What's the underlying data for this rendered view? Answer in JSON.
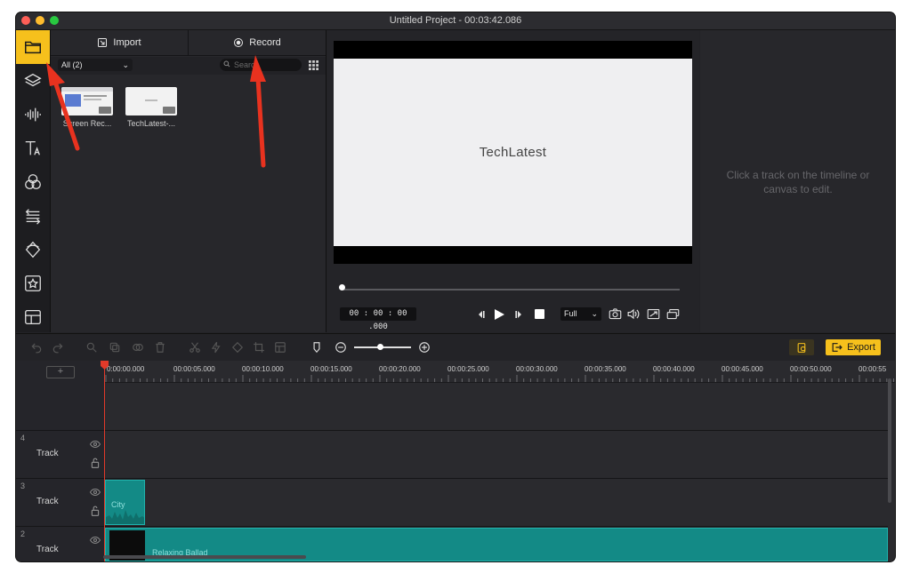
{
  "window": {
    "title": "Untitled Project - 00:03:42.086",
    "traffic_light_colors": [
      "#fe5f57",
      "#febc2e",
      "#28c840"
    ]
  },
  "sidebar": {
    "items": [
      {
        "name": "folder-icon",
        "active": true
      },
      {
        "name": "layers-icon",
        "active": false
      },
      {
        "name": "audio-waveform-icon",
        "active": false
      },
      {
        "name": "text-icon",
        "active": false
      },
      {
        "name": "filters-icon",
        "active": false
      },
      {
        "name": "transitions-icon",
        "active": false
      },
      {
        "name": "overlays-icon",
        "active": false
      },
      {
        "name": "stickers-icon",
        "active": false
      },
      {
        "name": "templates-icon",
        "active": false
      }
    ],
    "accent": "#f6c01c"
  },
  "media": {
    "import_label": "Import",
    "record_label": "Record",
    "filter_value": "All (2)",
    "search_placeholder": "Search",
    "items": [
      {
        "caption": "Screen Rec..."
      },
      {
        "caption": "TechLatest-..."
      }
    ]
  },
  "preview": {
    "canvas_text": "TechLatest",
    "timecode": "00 : 00 : 00 .000",
    "quality_value": "Full"
  },
  "properties": {
    "hint": "Click a track on the timeline or canvas to edit."
  },
  "toolbar": {
    "export_label": "Export",
    "zoom_level": 0.45
  },
  "timeline": {
    "ruler": [
      "0:00:00.000",
      "00:00:05.000",
      "00:00:10.000",
      "00:00:15.000",
      "00:00:20.000",
      "00:00:25.000",
      "00:00:30.000",
      "00:00:35.000",
      "00:00:40.000",
      "00:00:45.000",
      "00:00:50.000",
      "00:00:55"
    ],
    "tracks": [
      {
        "number": "4",
        "name": "Track"
      },
      {
        "number": "3",
        "name": "Track"
      },
      {
        "number": "2",
        "name": "Track"
      }
    ],
    "clips": [
      {
        "track": "3",
        "label": "City"
      },
      {
        "track": "2",
        "label": "Relaxing Ballad"
      }
    ],
    "clip_color": "#138a86"
  }
}
